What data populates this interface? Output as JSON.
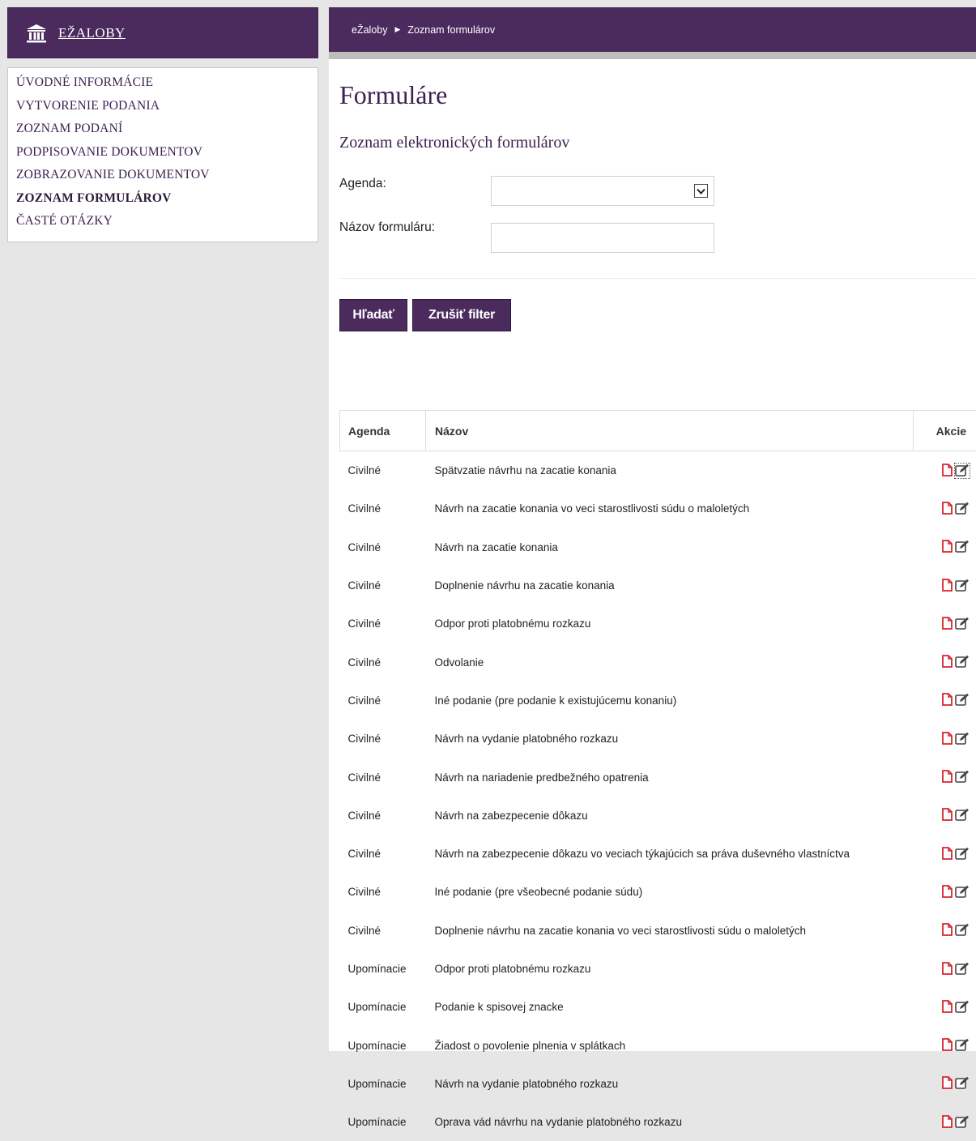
{
  "brand": {
    "title": "EŽALOBY"
  },
  "nav": {
    "items": [
      {
        "label": "ÚVODNÉ INFORMÁCIE"
      },
      {
        "label": "VYTVORENIE PODANIA"
      },
      {
        "label": "ZOZNAM PODANÍ"
      },
      {
        "label": "PODPISOVANIE DOKUMENTOV"
      },
      {
        "label": "ZOBRAZOVANIE DOKUMENTOV"
      },
      {
        "label": "ZOZNAM FORMULÁROV",
        "active": true
      },
      {
        "label": "ČASTÉ OTÁZKY"
      }
    ]
  },
  "breadcrumb": {
    "root": "eŽaloby",
    "current": "Zoznam formulárov"
  },
  "page": {
    "title": "Formuláre",
    "section_title": "Zoznam elektronických formulárov"
  },
  "filters": {
    "agenda_label": "Agenda:",
    "agenda_value": "",
    "nazov_label": "Názov formuláru:",
    "nazov_value": ""
  },
  "buttons": {
    "search": "Hľadať",
    "cancel_filter": "Zrušiť filter"
  },
  "table": {
    "headers": {
      "agenda": "Agenda",
      "nazov": "Názov",
      "akcie": "Akcie"
    },
    "rows": [
      {
        "agenda": "Civilné",
        "nazov": "Spätvzatie návrhu na zacatie konania"
      },
      {
        "agenda": "Civilné",
        "nazov": "Návrh na zacatie konania vo veci starostlivosti súdu o maloletých"
      },
      {
        "agenda": "Civilné",
        "nazov": "Návrh na zacatie konania"
      },
      {
        "agenda": "Civilné",
        "nazov": "Doplnenie návrhu na zacatie konania"
      },
      {
        "agenda": "Civilné",
        "nazov": "Odpor proti platobnému rozkazu"
      },
      {
        "agenda": "Civilné",
        "nazov": "Odvolanie"
      },
      {
        "agenda": "Civilné",
        "nazov": "Iné podanie (pre podanie k existujúcemu konaniu)"
      },
      {
        "agenda": "Civilné",
        "nazov": "Návrh na vydanie platobného rozkazu"
      },
      {
        "agenda": "Civilné",
        "nazov": "Návrh na nariadenie predbežného opatrenia"
      },
      {
        "agenda": "Civilné",
        "nazov": "Návrh na zabezpecenie dôkazu"
      },
      {
        "agenda": "Civilné",
        "nazov": "Návrh na zabezpecenie dôkazu vo veciach týkajúcich sa práva duševného vlastníctva"
      },
      {
        "agenda": "Civilné",
        "nazov": "Iné podanie (pre všeobecné podanie súdu)"
      },
      {
        "agenda": "Civilné",
        "nazov": "Doplnenie návrhu na zacatie konania vo veci starostlivosti súdu o maloletých"
      },
      {
        "agenda": "Upomínacie",
        "nazov": "Odpor proti platobnému rozkazu"
      },
      {
        "agenda": "Upomínacie",
        "nazov": "Podanie k spisovej znacke"
      },
      {
        "agenda": "Upomínacie",
        "nazov": "Žiadost o povolenie plnenia v splátkach"
      },
      {
        "agenda": "Upomínacie",
        "nazov": "Návrh na vydanie platobného rozkazu"
      },
      {
        "agenda": "Upomínacie",
        "nazov": "Oprava vád návrhu na vydanie platobného rozkazu"
      }
    ],
    "action_icons": [
      "pdf-document-icon",
      "edit-form-icon"
    ]
  },
  "colors": {
    "brand_purple": "#4b2a5e",
    "nav_text": "#3c2250",
    "pdf_icon_red": "#d9232e",
    "edit_icon_dark": "#444444"
  }
}
